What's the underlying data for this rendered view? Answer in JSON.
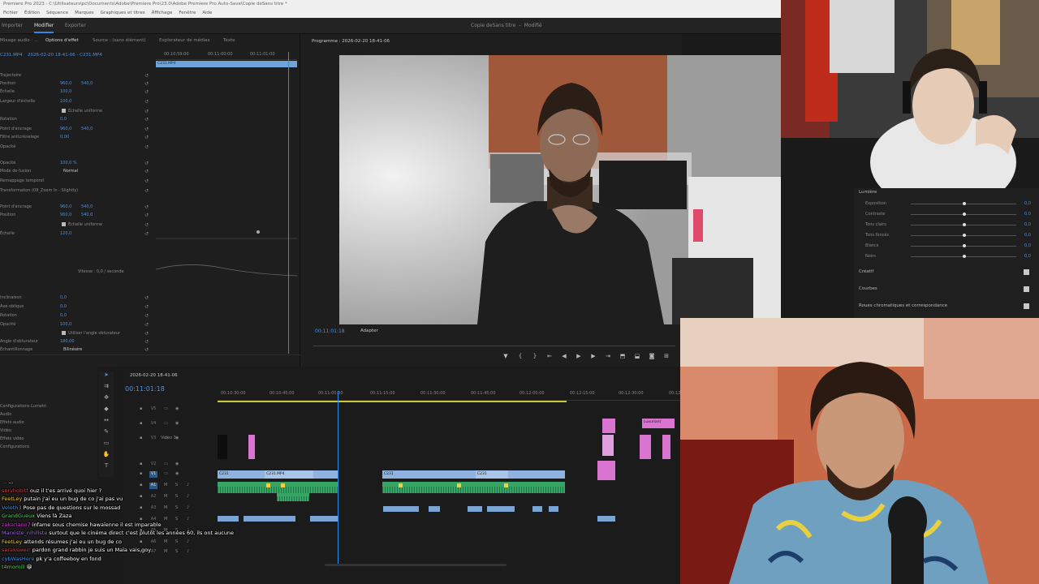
{
  "app": {
    "title": "Premiere Pro 2023 - C:\\Utilisateurs\\pc\\Documents\\Adobe\\Premiere Pro\\23.0\\Adobe Premiere Pro Auto-Save\\Copie deSans titre *",
    "menu": [
      "Fichier",
      "Édition",
      "Séquence",
      "Marques",
      "Graphiques et titres",
      "Affichage",
      "Fenêtre",
      "Aide"
    ],
    "workspaces": [
      "Importer",
      "Modifier",
      "Exporter"
    ],
    "active_workspace": "Modifier",
    "sequence_name": "Copie deSans titre",
    "sequence_status": "Modifié"
  },
  "effect_controls": {
    "tabs": [
      "Mixage audio : ...",
      "Options d'effet",
      "Source : (sans élément)",
      "Explorateur de médias",
      "Texte"
    ],
    "clip_source": "C231.MP4",
    "clip_path": "2026-02-20 18-41-06 - C231.MP4",
    "ruler": [
      "00:10:59:00",
      "00:11:00:00",
      "00:11:01:00"
    ],
    "clip_bar": "C231.MP4",
    "rows": [
      {
        "name": "Trajectoire",
        "v1": "",
        "v2": ""
      },
      {
        "name": "Position",
        "v1": "960,0",
        "v2": "540,0"
      },
      {
        "name": "Échelle",
        "v1": "100,0",
        "v2": ""
      },
      {
        "name": "Largeur d'échelle",
        "v1": "100,0",
        "v2": ""
      },
      {
        "name": "Échelle uniforme",
        "v1": "",
        "v2": "",
        "check": true
      },
      {
        "name": "Rotation",
        "v1": "0,0",
        "v2": ""
      },
      {
        "name": "Point d'ancrage",
        "v1": "960,0",
        "v2": "540,0"
      },
      {
        "name": "Filtre anticrénelage",
        "v1": "0,00",
        "v2": ""
      },
      {
        "name": "Opacité",
        "v1": "",
        "v2": ""
      },
      {
        "name": "Opacité",
        "v1": "100,0 %",
        "v2": ""
      },
      {
        "name": "Mode de fusion",
        "v1": "",
        "v2": "",
        "dd": "Normal"
      },
      {
        "name": "Remappage temporel",
        "v1": "",
        "v2": ""
      },
      {
        "name": "Transformation (08_Zoom In - Slightly)",
        "v1": "",
        "v2": ""
      },
      {
        "name": "Point d'ancrage",
        "v1": "960,0",
        "v2": "540,0"
      },
      {
        "name": "Position",
        "v1": "960,0",
        "v2": "540,0"
      },
      {
        "name": "Échelle uniforme",
        "v1": "",
        "v2": "",
        "check": true
      },
      {
        "name": "Échelle",
        "v1": "120,0",
        "v2": ""
      }
    ],
    "speed_label": "Vitesse : 0,0 / seconde",
    "rows2": [
      {
        "name": "Inclinaison",
        "v1": "0,0"
      },
      {
        "name": "Axe oblique",
        "v1": "0,0"
      },
      {
        "name": "Rotation",
        "v1": "0,0"
      },
      {
        "name": "Opacité",
        "v1": "100,0"
      },
      {
        "name": "Utiliser l'angle obturateur",
        "v1": "",
        "check": true
      },
      {
        "name": "Angle d'obturateur",
        "v1": "180,00"
      },
      {
        "name": "Échantillonnage",
        "v1": "",
        "dd": "Bilinéaire"
      }
    ]
  },
  "program": {
    "title": "Programme : 2026-02-20 18-41-06",
    "timecode": "00:11:01:18",
    "fit": "Adapter",
    "controls": [
      "marker-icon",
      "in-icon",
      "out-icon",
      "go-in-icon",
      "step-back-icon",
      "play-icon",
      "step-fwd-icon",
      "go-out-icon",
      "lift-icon",
      "extract-icon",
      "export-frame-icon",
      "settings-icon"
    ]
  },
  "lumetri": {
    "section": "Lumière",
    "sliders": [
      {
        "name": "Exposition",
        "value": "0,0"
      },
      {
        "name": "Contraste",
        "value": "0,0"
      },
      {
        "name": "Tons clairs",
        "value": "0,0"
      },
      {
        "name": "Tons foncés",
        "value": "0,0"
      },
      {
        "name": "Blancs",
        "value": "0,0"
      },
      {
        "name": "Noirs",
        "value": "0,0"
      }
    ],
    "sections": [
      "Créatif",
      "Courbes",
      "Roues chromatiques et correspondance"
    ]
  },
  "project": {
    "items": [
      "Configurations Lumetri",
      "Audio",
      "Effets audio",
      "Vidéo",
      "Effets vidéo",
      "Configurations"
    ]
  },
  "timeline": {
    "title": "2026-02-20 18-41-06",
    "timecode": "00:11:01:18",
    "ruler": [
      "00:10:30:00",
      "00:10:45:00",
      "00:11:00:00",
      "00:11:15:00",
      "00:11:30:00",
      "00:11:45:00",
      "00:12:00:00",
      "00:12:15:00",
      "00:12:30:00",
      "00:12"
    ],
    "tracks": [
      "V5",
      "V4",
      "V3",
      "V2",
      "V1",
      "A1",
      "A2",
      "A3",
      "A4",
      "A5",
      "A6",
      "A7"
    ],
    "clip_labels": [
      "C231",
      "C231.MP4",
      "C231",
      "C231",
      "Luxuriant"
    ],
    "v3_name": "Vidéo 3"
  },
  "chat": [
    {
      "user": "...",
      "color": "#e04a4a",
      "text": "...",
      "partial": true
    },
    {
      "user": "servhobitt",
      "color": "#d14040",
      "text": "ouz il t'es arrivé quoi hier ?"
    },
    {
      "user": "FeetLey",
      "color": "#e6c84a",
      "text": "putain j'ai eu un bug de co j'ai pas vu"
    },
    {
      "user": "Veloth3",
      "color": "#4a90e2",
      "text": "Pose pas de questions sur le mossad"
    },
    {
      "user": "GrandGueux",
      "color": "#5ad15a",
      "text": "Viens là Zaza"
    },
    {
      "user": "zakariano7",
      "color": "#c040c0",
      "text": "infame sous chemise hawaïenne il est imparable"
    },
    {
      "user": "Marxiste_nihiliste",
      "color": "#9b6bd6",
      "text": "surtout que le cinéma direct c'est plutôt les années 60, ils ont aucune"
    },
    {
      "user": "FeetLey",
      "color": "#e6c84a",
      "text": "attends résumes j'ai eu un bug de co"
    },
    {
      "user": "sarakswerr",
      "color": "#d14040",
      "text": "pardon grand rabbin je suis un Maïa vais goy"
    },
    {
      "user": "cybWasHere",
      "color": "#4a90e2",
      "text": "pk y'a coffeeboy en fond"
    },
    {
      "user": "t4momill",
      "color": "#5ad15a",
      "text": "😀"
    }
  ]
}
